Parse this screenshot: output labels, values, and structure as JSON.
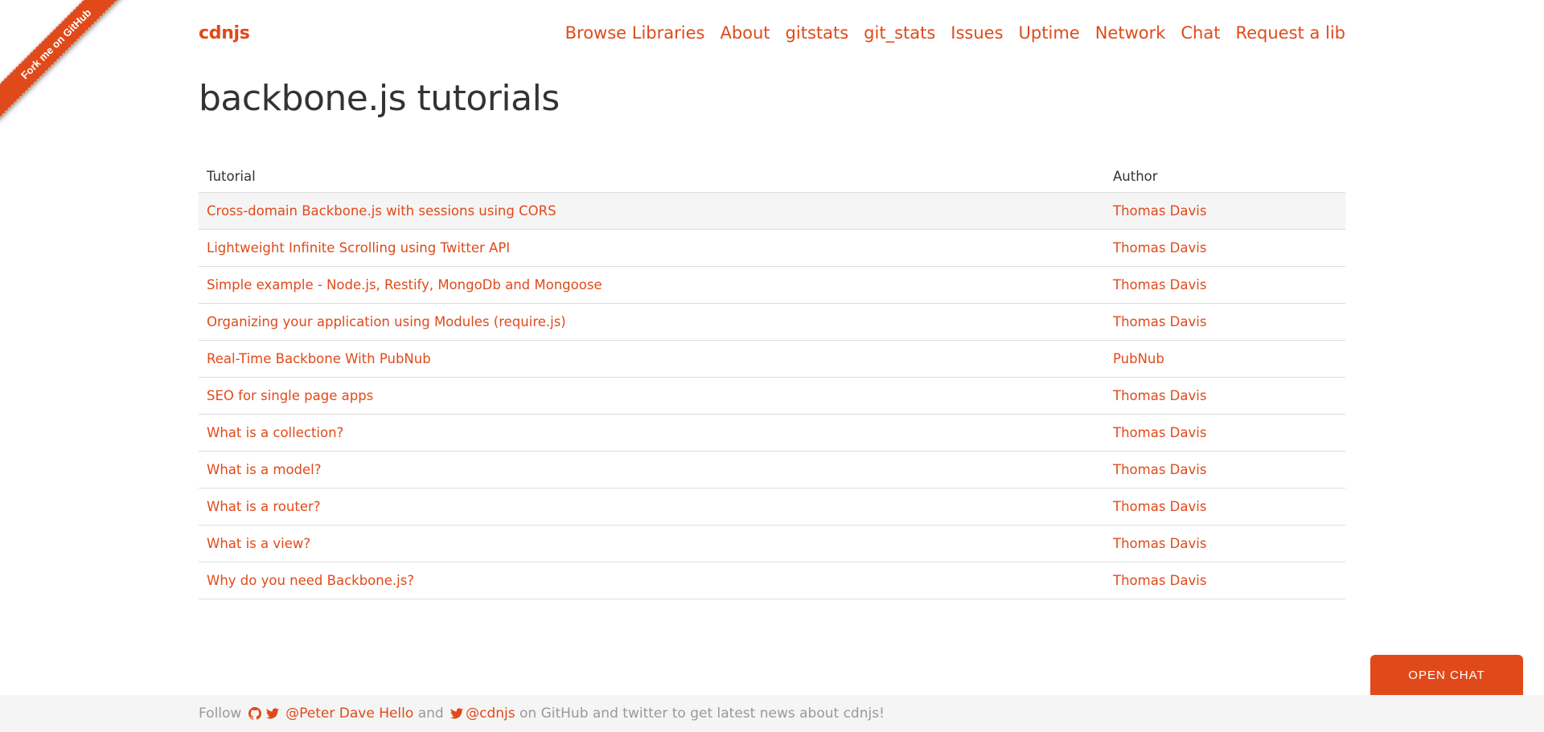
{
  "ribbon": {
    "label": "Fork me on GitHub"
  },
  "navbar": {
    "brand": "cdnjs",
    "links": [
      "Browse Libraries",
      "About",
      "gitstats",
      "git_stats",
      "Issues",
      "Uptime",
      "Network",
      "Chat",
      "Request a lib"
    ]
  },
  "page": {
    "title": "backbone.js tutorials"
  },
  "table": {
    "headers": {
      "tutorial": "Tutorial",
      "author": "Author"
    },
    "rows": [
      {
        "tutorial": "Cross-domain Backbone.js with sessions using CORS",
        "author": "Thomas Davis"
      },
      {
        "tutorial": "Lightweight Infinite Scrolling using Twitter API",
        "author": "Thomas Davis"
      },
      {
        "tutorial": "Simple example - Node.js, Restify, MongoDb and Mongoose",
        "author": "Thomas Davis"
      },
      {
        "tutorial": "Organizing your application using Modules (require.js)",
        "author": "Thomas Davis"
      },
      {
        "tutorial": "Real-Time Backbone With PubNub",
        "author": "PubNub"
      },
      {
        "tutorial": "SEO for single page apps",
        "author": "Thomas Davis"
      },
      {
        "tutorial": "What is a collection?",
        "author": "Thomas Davis"
      },
      {
        "tutorial": "What is a model?",
        "author": "Thomas Davis"
      },
      {
        "tutorial": "What is a router?",
        "author": "Thomas Davis"
      },
      {
        "tutorial": "What is a view?",
        "author": "Thomas Davis"
      },
      {
        "tutorial": "Why do you need Backbone.js?",
        "author": "Thomas Davis"
      }
    ]
  },
  "chat": {
    "label": "OPEN CHAT"
  },
  "footer": {
    "follow": "Follow",
    "github_icon": "github-icon",
    "twitter_icon": "twitter-icon",
    "person_link": "@Peter Dave Hello",
    "and": "and",
    "cdnjs_link": "@cdnjs",
    "suffix": "on GitHub and twitter to get latest news about cdnjs!"
  },
  "colors": {
    "accent": "#e04a1a",
    "footer_bg": "#f5f5f5",
    "muted": "#999999"
  }
}
